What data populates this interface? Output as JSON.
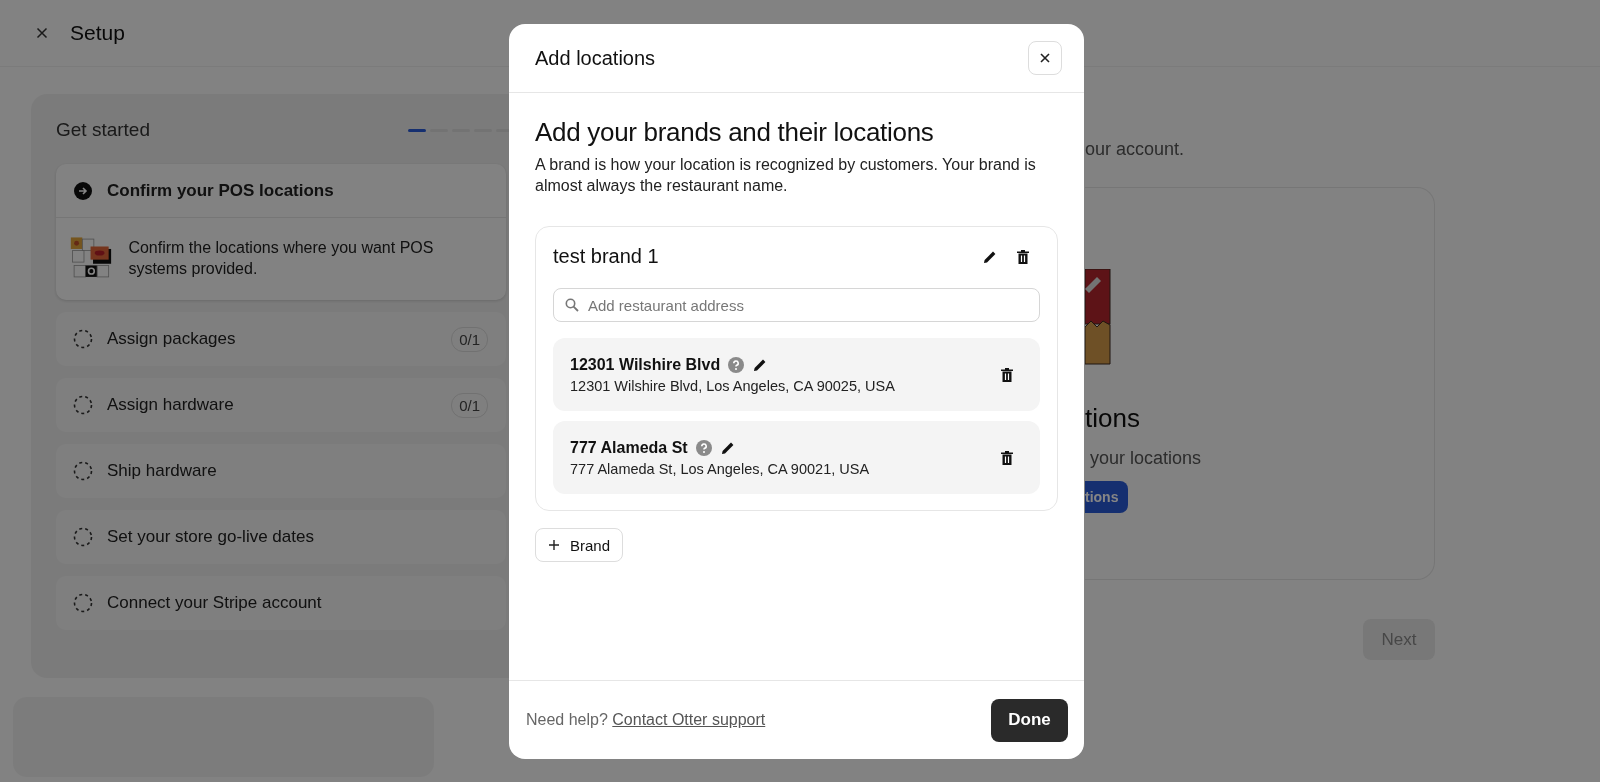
{
  "header": {
    "title": "Setup"
  },
  "checklist": {
    "title": "Get started",
    "progress": {
      "level": 0.1667
    },
    "steps": [
      {
        "kind": "active",
        "label": "Confirm your POS locations",
        "description": "Confirm the locations where you want POS systems provided."
      },
      {
        "kind": "todo",
        "label": "Assign packages",
        "count": "0/1"
      },
      {
        "kind": "todo",
        "label": "Assign hardware",
        "count": "0/1"
      },
      {
        "kind": "todo",
        "label": "Ship hardware"
      },
      {
        "kind": "todo",
        "label": "Set your store go-live dates"
      },
      {
        "kind": "todo",
        "label": "Connect your Stripe account"
      }
    ]
  },
  "main": {
    "subtitle": "our account.",
    "card": {
      "title": "tions",
      "text": "your locations",
      "button": "tions"
    },
    "next_button": {
      "label": "Next",
      "disabled": true
    }
  },
  "modal": {
    "title": "Add locations",
    "heading": "Add your brands and their locations",
    "description": "A brand is how your location is recognized by customers. Your brand is almost always the restaurant name.",
    "brands": [
      {
        "name": "test brand 1",
        "search": {
          "placeholder": "Add restaurant address"
        },
        "locations": [
          {
            "name": "12301 Wilshire Blvd",
            "address": "12301 Wilshire Blvd, Los Angeles, CA 90025, USA"
          },
          {
            "name": "777 Alameda St",
            "address": "777 Alameda St, Los Angeles, CA 90021, USA"
          }
        ]
      }
    ],
    "add_brand_button": "Brand",
    "footer": {
      "help_text": "Need help?",
      "link": "Contact Otter support",
      "done_button": "Done"
    }
  }
}
